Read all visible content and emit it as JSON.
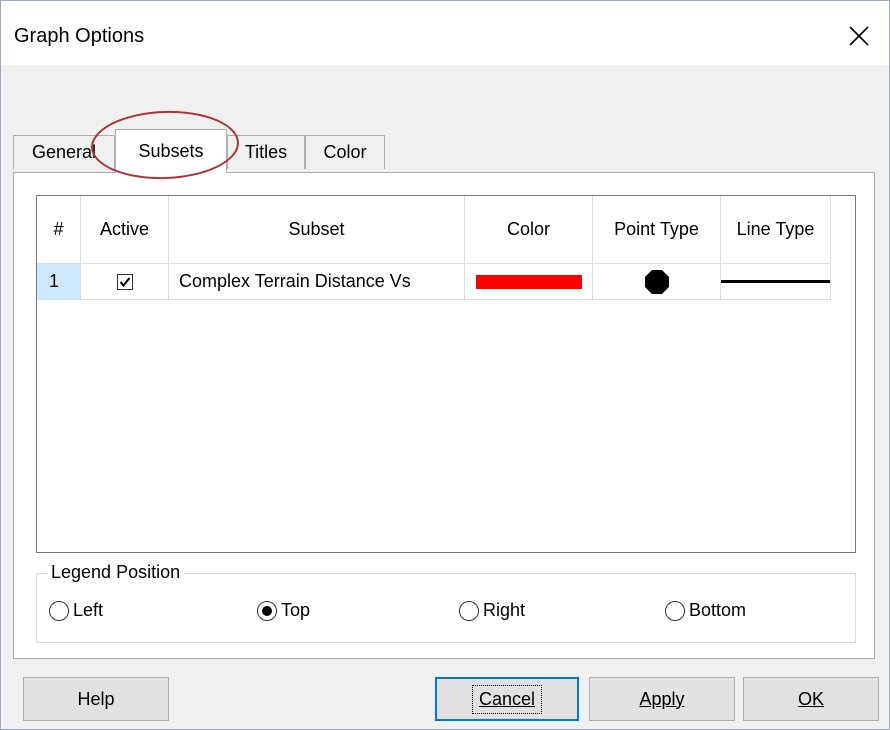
{
  "window": {
    "title": "Graph Options"
  },
  "tabs": [
    {
      "label": "General"
    },
    {
      "label": "Subsets"
    },
    {
      "label": "Titles"
    },
    {
      "label": "Color"
    }
  ],
  "grid": {
    "columns": [
      "#",
      "Active",
      "Subset",
      "Color",
      "Point Type",
      "Line Type"
    ],
    "rows": [
      {
        "index": "1",
        "active": true,
        "subset": "Complex Terrain Distance Vs",
        "color": "#ff0000",
        "point_type": "filled-octagon",
        "line_type": "solid"
      }
    ]
  },
  "legend": {
    "label": "Legend Position",
    "options": [
      "Left",
      "Top",
      "Right",
      "Bottom"
    ],
    "selected": "Top"
  },
  "buttons": {
    "help": "Help",
    "cancel": "Cancel",
    "apply": "Apply",
    "ok": "OK"
  },
  "colors": {
    "annotation": "#a8343a",
    "default_button_border": "#0078d7",
    "selected_row": "#cce8ff"
  }
}
